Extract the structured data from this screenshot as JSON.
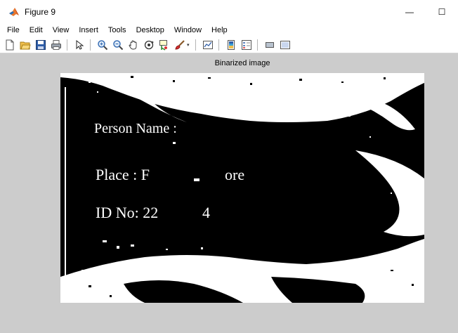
{
  "window": {
    "title": "Figure 9",
    "minimize_glyph": "—",
    "maximize_glyph": "☐"
  },
  "menu": [
    "File",
    "Edit",
    "View",
    "Insert",
    "Tools",
    "Desktop",
    "Window",
    "Help"
  ],
  "toolbar": {
    "icons": [
      "new-figure-icon",
      "open-file-icon",
      "save-figure-icon",
      "print-figure-icon",
      "edit-plot-arrow-icon",
      "zoom-in-icon",
      "zoom-out-icon",
      "pan-hand-icon",
      "rotate-3d-icon",
      "data-cursor-icon",
      "brush-icon",
      "link-plot-icon",
      "insert-colorbar-icon",
      "insert-legend-icon",
      "hide-plot-tools-icon",
      "show-plot-tools-icon"
    ]
  },
  "axes": {
    "title": "Binarized image"
  },
  "image_text": {
    "line1": "Person Name :",
    "line2": "Place : F",
    "line2_end": "ore",
    "line3": "ID No: 22",
    "line3_end": "4"
  },
  "colors": {
    "figure_bg": "#cccccc",
    "image_bg": "#000000",
    "image_fg": "#ffffff"
  }
}
